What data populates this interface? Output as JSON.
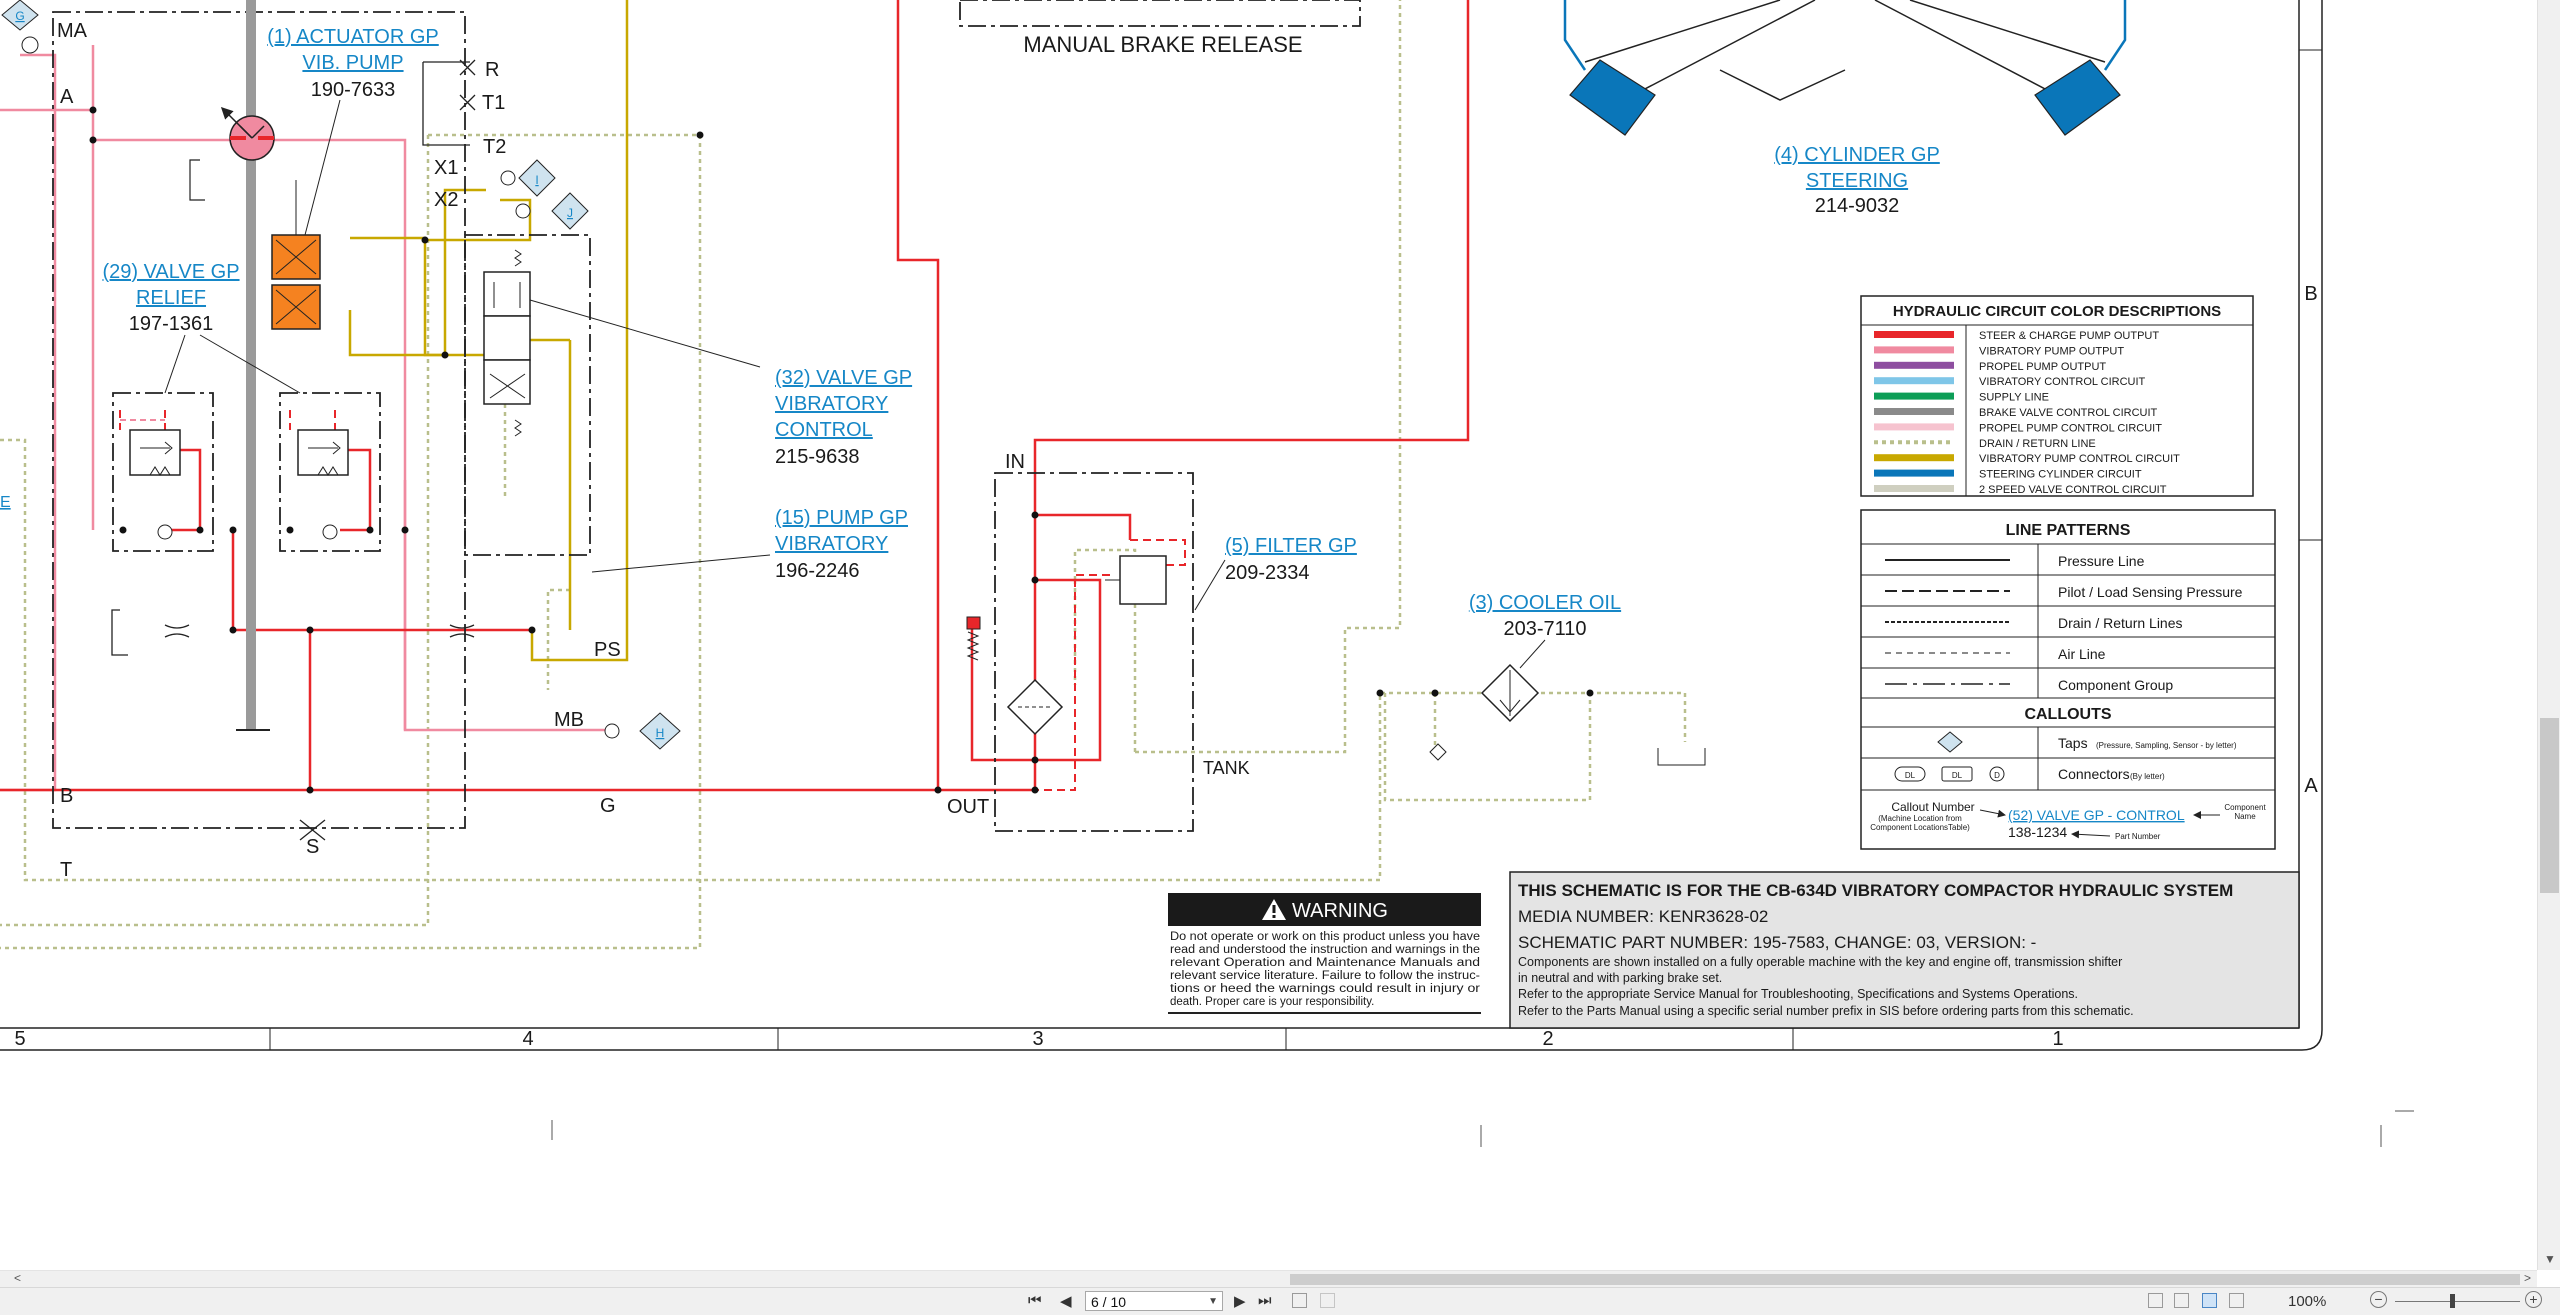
{
  "labels": {
    "ma": "MA",
    "a": "A",
    "r": "R",
    "t1": "T1",
    "t2": "T2",
    "x1": "X1",
    "x2": "X2",
    "tap_g": "G",
    "tap_i": "I",
    "tap_j": "J",
    "tap_h": "H",
    "mb": "MB",
    "b": "B",
    "g": "G",
    "s": "S",
    "t": "T",
    "ps": "PS",
    "in": "IN",
    "out": "OUT",
    "tank": "TANK",
    "e": "E",
    "manual_brake": "MANUAL BRAKE RELEASE"
  },
  "components": {
    "actuator": {
      "l1": "(1) ACTUATOR GP",
      "l2": "VIB. PUMP",
      "num": "190-7633"
    },
    "relief": {
      "l1": "(29) VALVE GP",
      "l2": "RELIEF",
      "num": "197-1361"
    },
    "vib_control": {
      "l1": "(32) VALVE GP",
      "l2": "VIBRATORY",
      "l3": "CONTROL",
      "num": "215-9638"
    },
    "pump": {
      "l1": "(15) PUMP GP",
      "l2": "VIBRATORY",
      "num": "196-2246"
    },
    "filter": {
      "l1": "(5) FILTER GP",
      "num": "209-2334"
    },
    "cooler": {
      "l1": "(3) COOLER OIL",
      "num": "203-7110"
    },
    "cylinder": {
      "l1": "(4) CYLINDER GP",
      "l2": "STEERING",
      "num": "214-9032"
    }
  },
  "color_legend": {
    "title": "HYDRAULIC CIRCUIT COLOR DESCRIPTIONS",
    "items": [
      {
        "label": "STEER & CHARGE PUMP OUTPUT",
        "color": "#e8262a"
      },
      {
        "label": "VIBRATORY PUMP OUTPUT",
        "color": "#f08aa0"
      },
      {
        "label": "PROPEL PUMP OUTPUT",
        "color": "#8e4ea0"
      },
      {
        "label": "VIBRATORY CONTROL CIRCUIT",
        "color": "#7fc6e8"
      },
      {
        "label": "SUPPLY LINE",
        "color": "#0d9e57"
      },
      {
        "label": "BRAKE VALVE CONTROL CIRCUIT",
        "color": "#8a8a8a"
      },
      {
        "label": "PROPEL PUMP CONTROL CIRCUIT",
        "color": "#f6c3cf"
      },
      {
        "label": "DRAIN / RETURN LINE",
        "color": "#b9bf8c"
      },
      {
        "label": "VIBRATORY PUMP CONTROL CIRCUIT",
        "color": "#c8a800"
      },
      {
        "label": "STEERING CYLINDER CIRCUIT",
        "color": "#0a76b9"
      },
      {
        "label": "2 SPEED VALVE CONTROL CIRCUIT",
        "color": "#cfcfc0"
      }
    ]
  },
  "line_patterns": {
    "title": "LINE PATTERNS",
    "items": [
      "Pressure Line",
      "Pilot / Load Sensing Pressure",
      "Drain / Return Lines",
      "Air Line",
      "Component Group"
    ]
  },
  "callouts": {
    "title": "CALLOUTS",
    "taps": "Taps",
    "taps_note": "(Pressure, Sampling, Sensor - by letter)",
    "connectors": "Connectors",
    "connectors_note": "(By letter)",
    "dl": "DL",
    "d": "D",
    "callout_number": "Callout Number",
    "callout_note1": "(Machine Location from",
    "callout_note2": "Component LocationsTable)",
    "example_link": "(52) VALVE GP - CONTROL",
    "component": "Component",
    "name": "Name",
    "example_num": "138-1234",
    "part_number": "Part Number"
  },
  "warning": {
    "title": "WARNING",
    "lines": [
      "Do not operate or work on this product unless you have",
      "read and understood the instruction and warnings in the",
      "relevant Operation and Maintenance Manuals and",
      "relevant service literature. Failure to follow the instruc-",
      "tions or heed the warnings could result in injury or",
      "death. Proper care is your responsibility."
    ]
  },
  "titleblock": {
    "title": "THIS SCHEMATIC IS FOR THE CB-634D VIBRATORY COMPACTOR HYDRAULIC SYSTEM",
    "media": "MEDIA NUMBER: KENR3628-02",
    "part": "SCHEMATIC PART NUMBER: 195-7583, CHANGE: 03, VERSION: -",
    "n1": "Components are shown installed on a fully operable machine with the key and engine off, transmission shifter",
    "n2": "in neutral and with parking brake set.",
    "n3": "Refer to the appropriate Service Manual for Troubleshooting, Specifications and Systems Operations.",
    "n4": "Refer to the Parts Manual using a specific serial number prefix in SIS before ordering parts from this schematic."
  },
  "grid": {
    "cols": [
      "5",
      "4",
      "3",
      "2",
      "1"
    ],
    "rows": [
      "B",
      "A"
    ]
  },
  "viewer": {
    "page": "6 / 10",
    "zoom": "100%",
    "first": "⏮",
    "prev": "◀",
    "next": "▶",
    "last": "⏭",
    "zoom_out": "−",
    "zoom_in": "+",
    "scroll_up": "▲",
    "scroll_down": "▼",
    "scroll_left": "<",
    "scroll_right": ">"
  }
}
